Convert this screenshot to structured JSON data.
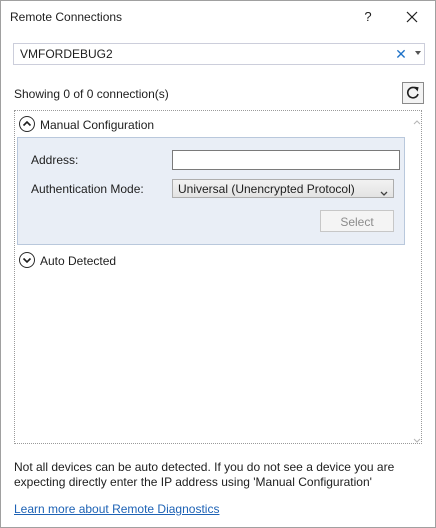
{
  "window": {
    "title": "Remote Connections",
    "help_label": "?"
  },
  "device_combo": {
    "value": "VMFORDEBUG2",
    "clear_glyph": "✕"
  },
  "status": {
    "showing_text": "Showing 0 of 0 connection(s)"
  },
  "manual_config": {
    "header_label": "Manual Configuration",
    "address_label": "Address:",
    "address_value": "",
    "auth_label": "Authentication Mode:",
    "auth_value": "Universal (Unencrypted Protocol)",
    "select_button": "Select"
  },
  "auto_detected": {
    "header_label": "Auto Detected"
  },
  "footer": {
    "note": "Not all devices can be auto detected. If you do not see a device you are expecting directly enter the IP address using 'Manual Configuration'",
    "learn_more": "Learn more about Remote Diagnostics"
  },
  "colors": {
    "accent": "#1d62b5",
    "panel_bg": "#e9eef6",
    "clear_icon": "#1e72c8"
  }
}
